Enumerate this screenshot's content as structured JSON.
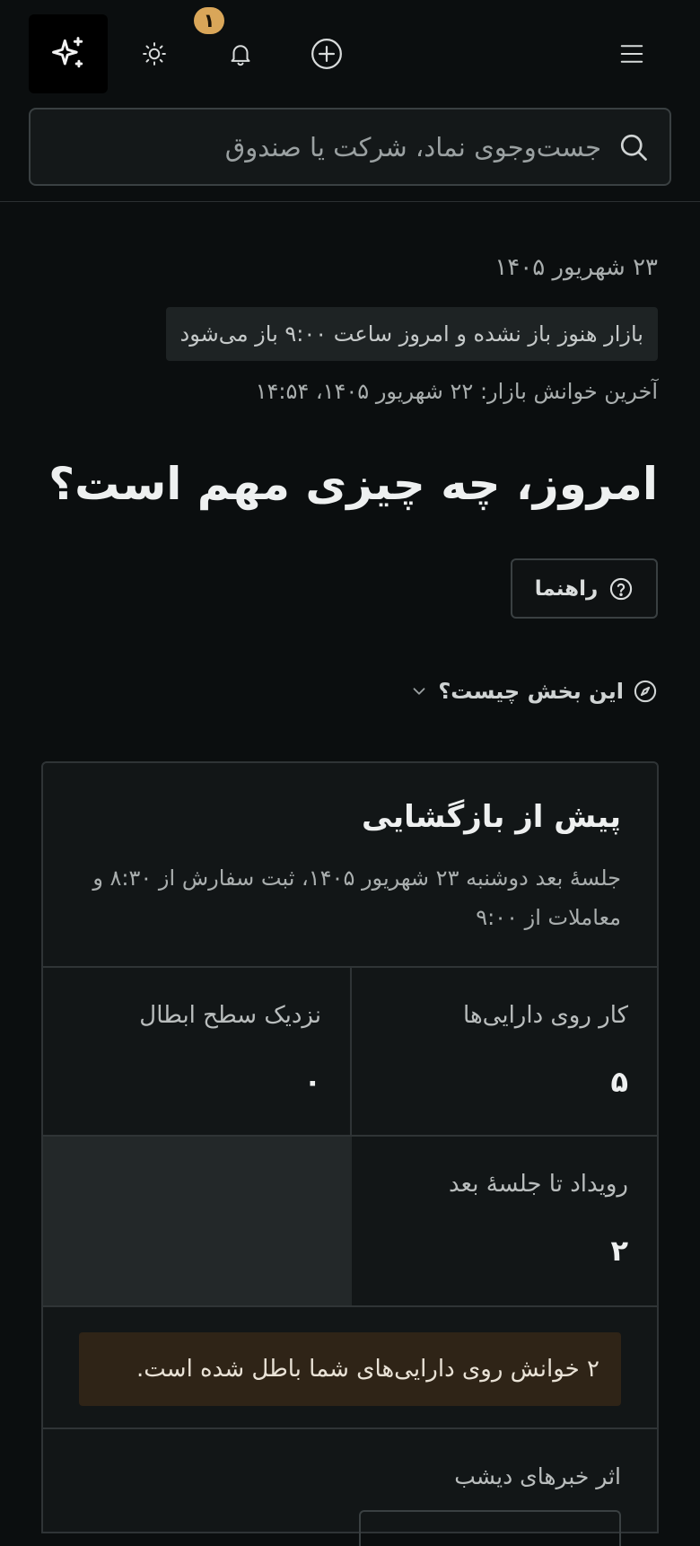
{
  "header": {
    "notification_count": "۱",
    "search_placeholder": "جست‌وجوی نماد، شرکت یا صندوق"
  },
  "status": {
    "date": "۲۳ شهریور ۱۴۰۵",
    "market_closed": "بازار هنوز باز نشده و امروز ساعت ۹:۰۰ باز می‌شود",
    "last_read": "آخرین خوانش بازار: ۲۲ شهریور ۱۴۰۵، ۱۴:۵۴"
  },
  "main": {
    "headline": "امروز، چه چیزی مهم است؟",
    "guide_label": "راهنما",
    "what_is_this": "این بخش چیست؟"
  },
  "card": {
    "title": "پیش از بازگشایی",
    "subtitle": "جلسهٔ بعد دوشنبه ۲۳ شهریور ۱۴۰۵، ثبت سفارش از ۸:۳۰ و معاملات از ۹:۰۰",
    "stats": [
      {
        "label": "کار روی دارایی‌ها",
        "value": "۵"
      },
      {
        "label": "نزدیک سطح ابطال",
        "value": "۰"
      },
      {
        "label": "رویداد تا جلسهٔ بعد",
        "value": "۲"
      }
    ],
    "warning": "۲ خوانش روی دارایی‌های شما باطل شده است.",
    "news_label": "اثر خبرهای دیشب"
  },
  "colors": {
    "background": "#0b0e0f",
    "card": "#121617",
    "badge": "#d9a659",
    "warning_bg": "#2f2417"
  },
  "icons": [
    "sparkles-icon",
    "sun-icon",
    "bell-icon",
    "plus-circle-icon",
    "menu-icon",
    "search-icon",
    "help-circle-icon",
    "compass-icon",
    "chevron-down-icon"
  ]
}
